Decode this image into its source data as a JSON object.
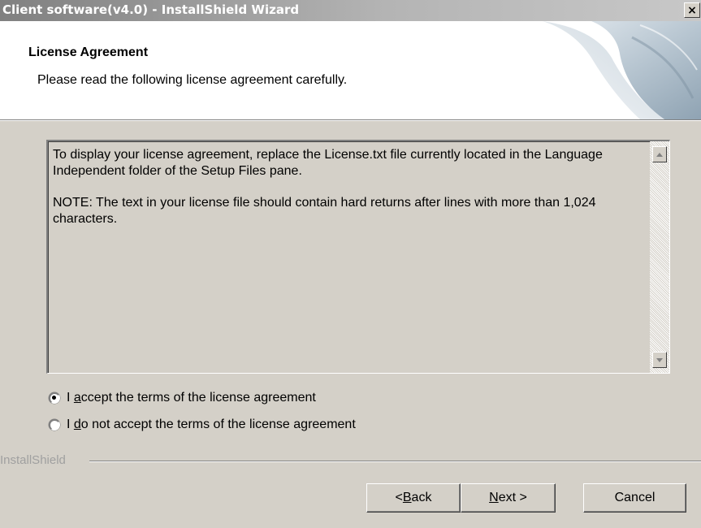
{
  "window": {
    "title": "Client software(v4.0) - InstallShield Wizard",
    "close_glyph": "×"
  },
  "header": {
    "title": "License Agreement",
    "subtitle": "Please read the following license agreement carefully."
  },
  "license": {
    "paragraphs": [
      "To display your license agreement, replace the License.txt file currently located in the Language Independent folder of the Setup Files pane.",
      "NOTE: The text in your license file should contain hard returns after lines with more than 1,024 characters."
    ]
  },
  "options": {
    "accept": {
      "prefix": "I ",
      "mnemonic": "a",
      "suffix": "ccept the terms of the license agreement",
      "selected": true
    },
    "decline": {
      "prefix": "I ",
      "mnemonic": "d",
      "suffix": "o not accept the terms of the license agreement",
      "selected": false
    }
  },
  "brand": {
    "label": "InstallShield"
  },
  "buttons": {
    "back": {
      "prefix": "< ",
      "mnemonic": "B",
      "suffix": "ack"
    },
    "next": {
      "prefix": "",
      "mnemonic": "N",
      "suffix": "ext >"
    },
    "cancel": {
      "label": "Cancel"
    }
  },
  "icons": {
    "close": "close-icon",
    "scroll_up": "arrow-up-icon",
    "scroll_down": "arrow-down-icon",
    "header_art": "page-curl-graphic"
  }
}
